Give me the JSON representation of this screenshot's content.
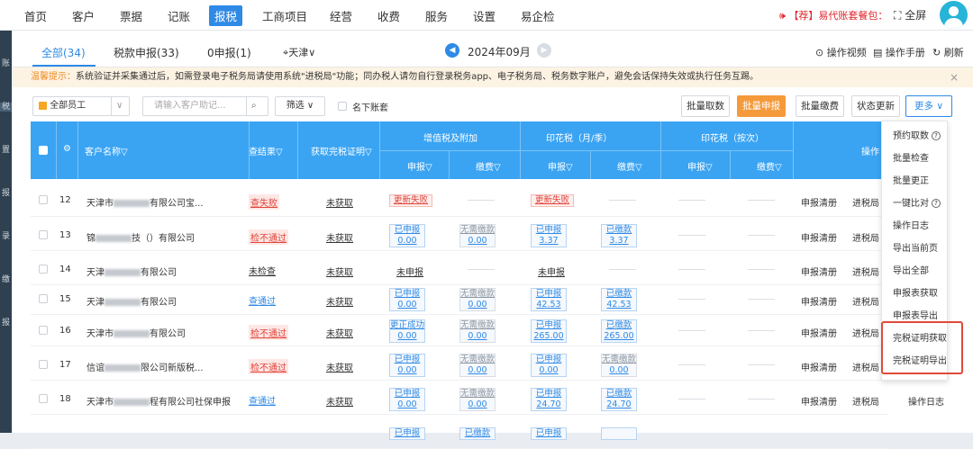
{
  "topbar": {
    "nav": [
      "首页",
      "客户",
      "票据",
      "记账",
      "报税",
      "工商项目",
      "经营",
      "收费",
      "服务",
      "设置",
      "易企检"
    ],
    "active_nav": "报税",
    "promo": "【荐】易代账套餐包：",
    "fullscreen": "全屏"
  },
  "sidebar": [
    "账",
    "税",
    "置",
    "报",
    "录",
    "缴",
    "报"
  ],
  "tabs": [
    {
      "label": "全部(34)",
      "active": true
    },
    {
      "label": "税款申报(33)",
      "active": false
    },
    {
      "label": "0申报(1)",
      "active": false
    },
    {
      "label": "天津",
      "active": false
    }
  ],
  "period": {
    "label": "2024年09月",
    "prev": "◀",
    "next": "▶"
  },
  "right_links": [
    "操作视频",
    "操作手册",
    "刷新"
  ],
  "notice": {
    "label": "温馨提示：",
    "text": "系统验证并采集通过后，如需登录电子税务局请使用系统\"进税局\"功能；同办税人请勿自行登录税务app、电子税务局、税务数字账户，避免会话保持失效或执行任务互踢。",
    "close": "×"
  },
  "toolbar": {
    "staff_select": "全部员工",
    "search_placeholder": "请输入客户助记...",
    "filter": "筛选",
    "checkbox_label": "名下账套",
    "buttons": [
      "批量取数",
      "批量申报",
      "批量缴费",
      "状态更新",
      "更多"
    ]
  },
  "table": {
    "headers": {
      "customer": "客户名称",
      "result": "查结果",
      "cert": "获取完税证明",
      "vat": "增值税及附加",
      "stamp_month": "印花税（月/季）",
      "stamp_each": "印花税（按次）",
      "declare": "申报",
      "pay": "缴费",
      "ops": "操作"
    },
    "rows": [
      {
        "no": "12",
        "name": "天津市",
        "name_tail": "有限公司宝...",
        "result": "查失败",
        "result_type": "fail",
        "cert": "未获取",
        "vat_decl": {
          "text": "更新失败",
          "amt": "",
          "type": "red"
        },
        "vat_pay": null,
        "stamp_decl": {
          "text": "更新失败",
          "amt": "",
          "type": "red"
        },
        "stamp_pay": null,
        "op1": "申报清册",
        "op2": "进税局"
      },
      {
        "no": "13",
        "name": "锦",
        "name_tail": "技（）有限公司",
        "result": "检不通过",
        "result_type": "fail",
        "cert": "未获取",
        "vat_decl": {
          "text": "已申报",
          "amt": "0.00",
          "type": "blue"
        },
        "vat_pay": {
          "text": "无需缴款",
          "amt": "0.00",
          "type": "gray"
        },
        "stamp_decl": {
          "text": "已申报",
          "amt": "3.37",
          "type": "blue"
        },
        "stamp_pay": {
          "text": "已缴款",
          "amt": "3.37",
          "type": "blue"
        },
        "op1": "申报清册",
        "op2": "进税局"
      },
      {
        "no": "14",
        "name": "天津",
        "name_tail": "有限公司",
        "result": "未检查",
        "result_type": "plain",
        "cert": "未获取",
        "vat_decl": {
          "text": "未申报",
          "amt": "",
          "type": "plain"
        },
        "vat_pay": null,
        "stamp_decl": {
          "text": "未申报",
          "amt": "",
          "type": "plain"
        },
        "stamp_pay": null,
        "op1": "申报清册",
        "op2": "进税局"
      },
      {
        "no": "15",
        "name": "天津",
        "name_tail": "有限公司",
        "result": "查通过",
        "result_type": "pass",
        "cert": "未获取",
        "vat_decl": {
          "text": "已申报",
          "amt": "0.00",
          "type": "blue"
        },
        "vat_pay": {
          "text": "无需缴款",
          "amt": "0.00",
          "type": "gray"
        },
        "stamp_decl": {
          "text": "已申报",
          "amt": "42.53",
          "type": "blue"
        },
        "stamp_pay": {
          "text": "已缴款",
          "amt": "42.53",
          "type": "blue"
        },
        "op1": "申报清册",
        "op2": "进税局"
      },
      {
        "no": "16",
        "name": "天津市",
        "name_tail": "有限公司",
        "result": "检不通过",
        "result_type": "fail",
        "cert": "未获取",
        "vat_decl": {
          "text": "更正成功",
          "amt": "0.00",
          "type": "blue"
        },
        "vat_pay": {
          "text": "无需缴款",
          "amt": "0.00",
          "type": "gray"
        },
        "stamp_decl": {
          "text": "已申报",
          "amt": "265.00",
          "type": "blue"
        },
        "stamp_pay": {
          "text": "已缴款",
          "amt": "265.00",
          "type": "blue"
        },
        "op1": "申报清册",
        "op2": "进税局"
      },
      {
        "no": "17",
        "name": "信谊",
        "name_tail": "限公司新版税...",
        "result": "检不通过",
        "result_type": "fail",
        "cert": "未获取",
        "vat_decl": {
          "text": "已申报",
          "amt": "0.00",
          "type": "blue"
        },
        "vat_pay": {
          "text": "无需缴款",
          "amt": "0.00",
          "type": "gray"
        },
        "stamp_decl": {
          "text": "已申报",
          "amt": "0.00",
          "type": "blue"
        },
        "stamp_pay": {
          "text": "无需缴款",
          "amt": "0.00",
          "type": "gray"
        },
        "op1": "申报清册",
        "op2": "进税局"
      },
      {
        "no": "18",
        "name": "天津市",
        "name_tail": "程有限公司社保申报",
        "result": "查通过",
        "result_type": "pass",
        "cert": "未获取",
        "vat_decl": {
          "text": "已申报",
          "amt": "0.00",
          "type": "blue"
        },
        "vat_pay": {
          "text": "无需缴款",
          "amt": "0.00",
          "type": "gray"
        },
        "stamp_decl": {
          "text": "已申报",
          "amt": "24.70",
          "type": "blue"
        },
        "stamp_pay": {
          "text": "已缴款",
          "amt": "24.70",
          "type": "blue"
        },
        "op1": "申报清册",
        "op2": "进税局"
      },
      {
        "no": "",
        "name": "",
        "name_tail": "",
        "result": "",
        "result_type": "plain",
        "cert": "",
        "vat_decl": {
          "text": "已申报",
          "amt": "",
          "type": "blue"
        },
        "vat_pay": {
          "text": "已缴款",
          "amt": "",
          "type": "blue"
        },
        "stamp_decl": {
          "text": "已申报",
          "amt": "",
          "type": "blue"
        },
        "stamp_pay": {
          "text": "",
          "amt": "",
          "type": "blue"
        },
        "op1": "",
        "op2": ""
      }
    ],
    "last_row_op3": "操作日志"
  },
  "more_menu": [
    {
      "label": "预约取数",
      "help": true
    },
    {
      "label": "批量检查",
      "help": false
    },
    {
      "label": "批量更正",
      "help": false
    },
    {
      "label": "一键比对",
      "help": true
    },
    {
      "label": "操作日志",
      "help": false
    },
    {
      "label": "导出当前页",
      "help": false
    },
    {
      "label": "导出全部",
      "help": false
    },
    {
      "label": "申报表获取",
      "help": false
    },
    {
      "label": "申报表导出",
      "help": false
    },
    {
      "label": "完税证明获取",
      "help": false
    },
    {
      "label": "完税证明导出",
      "help": false
    }
  ],
  "colors": {
    "primary": "#2e8ae6",
    "header": "#3aa4f3",
    "orange": "#f59a3a",
    "danger": "#e0453a"
  }
}
